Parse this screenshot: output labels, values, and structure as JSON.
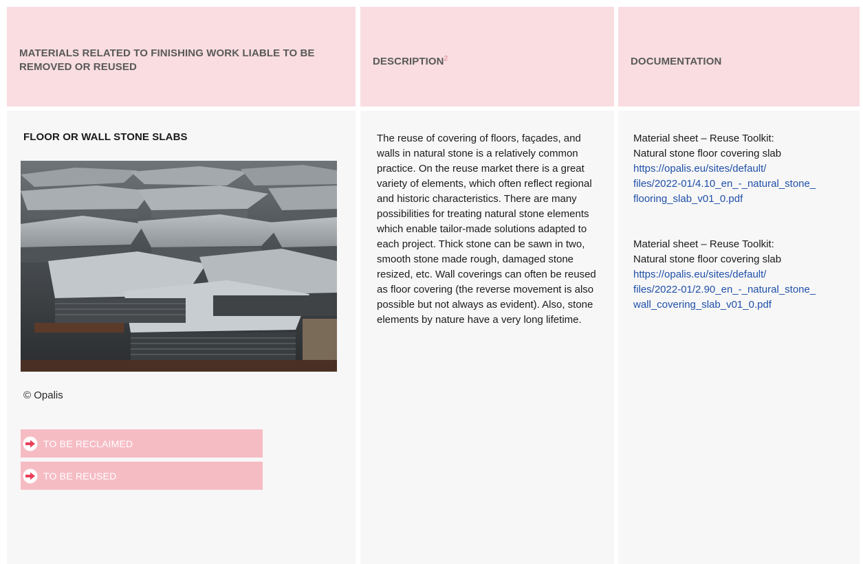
{
  "headers": {
    "materials": "MATERIALS RELATED TO FINISHING WORK LIABLE TO BE REMOVED OR REUSED",
    "description": "DESCRIPTION",
    "description_footnote": "2",
    "documentation": "DOCUMENTATION"
  },
  "item": {
    "title": "FLOOR OR WALL STONE SLABS",
    "credit": "© Opalis",
    "tags": [
      {
        "label": "TO BE RECLAIMED",
        "icon": "arrow-right-circle-icon"
      },
      {
        "label": "TO BE REUSED",
        "icon": "arrow-right-circle-icon"
      }
    ]
  },
  "description_text": "The reuse of covering of floors, façades, and walls in natural stone is a relatively common practice. On the reuse market there is a great variety of elements, which often reflect regional and historic characteristics. There are many possibilities for treating natural stone elements which enable tailor-made solutions adapted to each project. Thick stone can be sawn in two, smooth stone made rough, damaged stone resized, etc. Wall coverings can often be reused as floor covering (the reverse movement is also possible but not always as evident). Also, stone elements by nature have a very long lifetime.",
  "documentation": [
    {
      "line1": "Material sheet – Reuse Toolkit:",
      "line2": "Natural stone floor covering slab",
      "url": "https://opalis.eu/sites/default/\nfiles/2022-01/4.10_en_-_natural_stone_\nflooring_slab_v01_0.pdf"
    },
    {
      "line1": "Material sheet – Reuse Toolkit:",
      "line2": "Natural stone floor covering slab",
      "url": "https://opalis.eu/sites/default/\nfiles/2022-01/2.90_en_-_natural_stone_\nwall_covering_slab_v01_0.pdf"
    }
  ],
  "colors": {
    "header_bg": "#f9dde1",
    "body_bg": "#f7f7f7",
    "tag_bg": "#f6bcc4",
    "link": "#1f4fa8"
  }
}
